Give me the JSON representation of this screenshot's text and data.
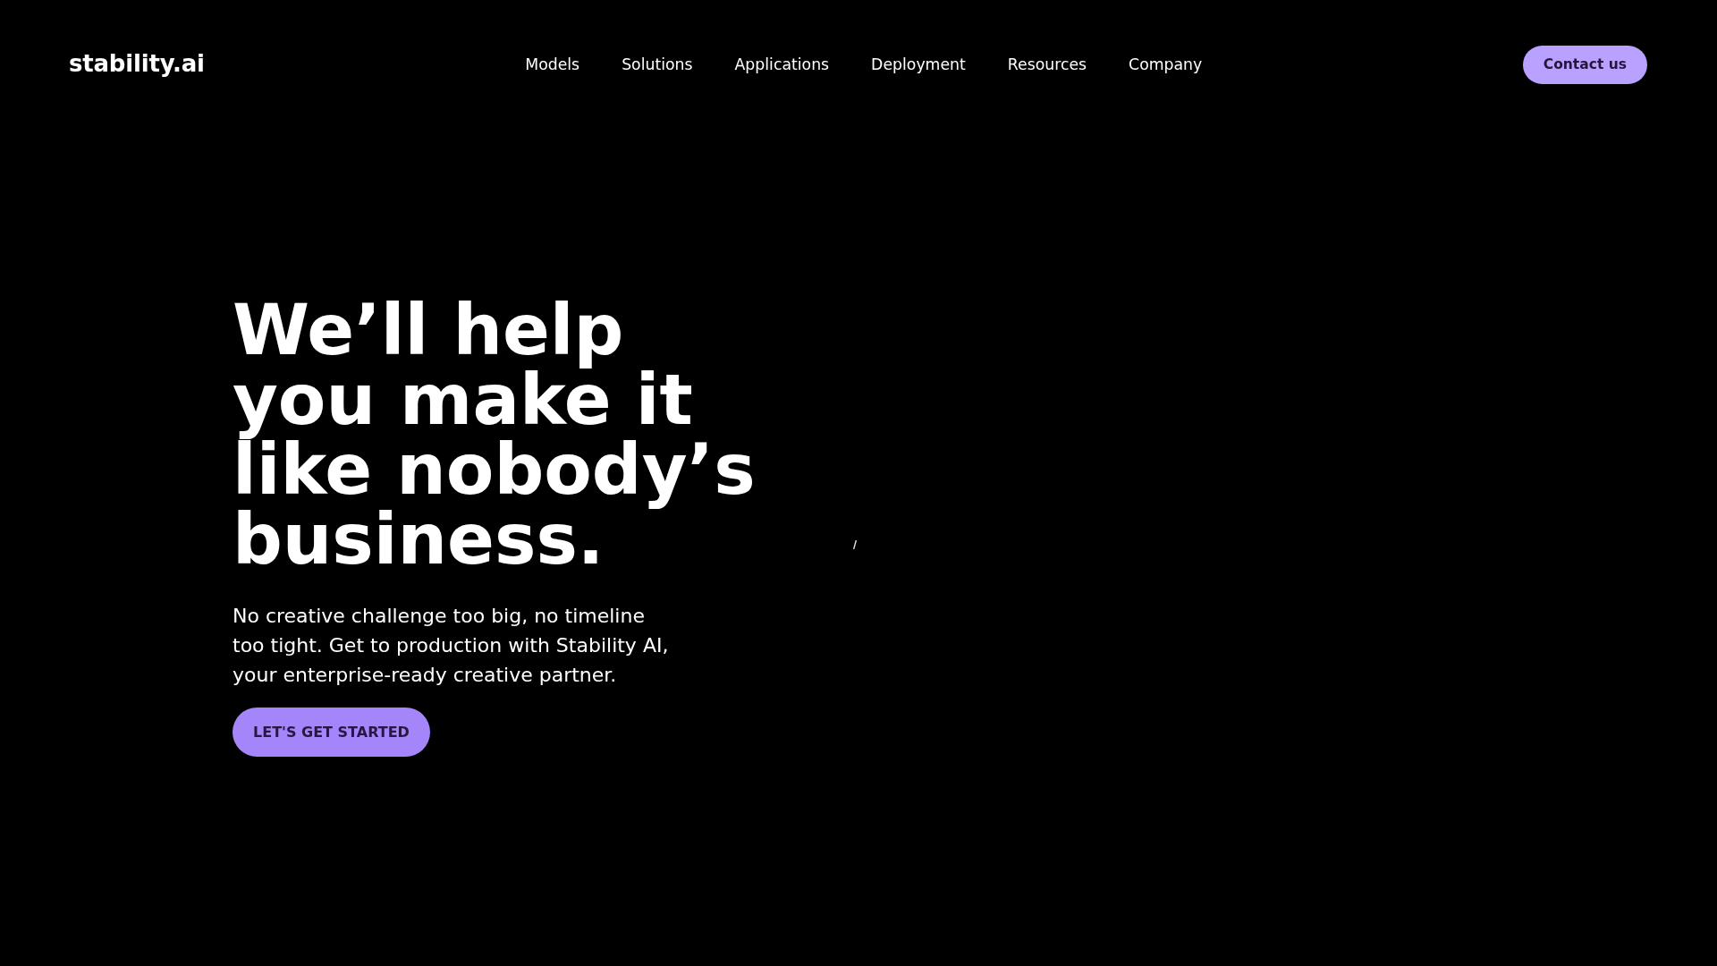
{
  "header": {
    "logo": "stability.ai",
    "nav": [
      "Models",
      "Solutions",
      "Applications",
      "Deployment",
      "Resources",
      "Company"
    ],
    "contact_button": "Contact us"
  },
  "hero": {
    "headline": "We’ll help you make it like nobody’s business.",
    "description": "No creative challenge too big, no timeline too tight. Get to production with Stability AI, your enterprise-ready creative partner.",
    "cta_button": "LET'S GET STARTED"
  }
}
